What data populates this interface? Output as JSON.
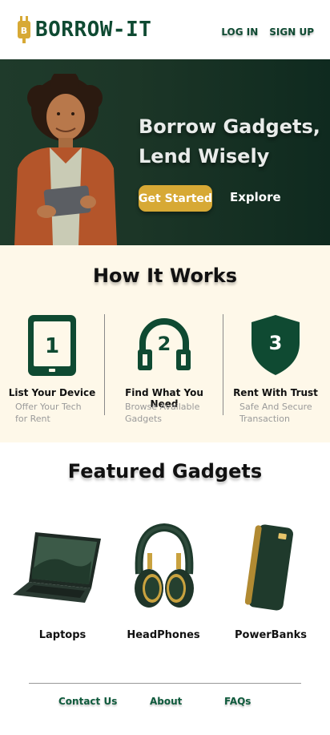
{
  "header": {
    "brand": "BORROW-IT",
    "login": "LOG IN",
    "signup": "SIGN UP"
  },
  "hero": {
    "title_line1": "Borrow Gadgets,",
    "title_line2": "Lend Wisely",
    "cta_primary": "Get Started",
    "cta_secondary": "Explore"
  },
  "how": {
    "title": "How It Works",
    "steps": [
      {
        "number": "1",
        "title": "List Your Device",
        "subtitle_line1": "Offer Your Tech",
        "subtitle_line2": "for Rent"
      },
      {
        "number": "2",
        "title": "Find What You Need",
        "subtitle_line1": "Browse Available",
        "subtitle_line2": "Gadgets"
      },
      {
        "number": "3",
        "title": "Rent With Trust",
        "subtitle_line1": "Safe And Secure",
        "subtitle_line2": "Transaction"
      }
    ]
  },
  "featured": {
    "title": "Featured Gadgets",
    "items": [
      {
        "label": "Laptops",
        "icon": "laptop-icon"
      },
      {
        "label": "HeadPhones",
        "icon": "headphones-icon"
      },
      {
        "label": "PowerBanks",
        "icon": "powerbank-icon"
      }
    ]
  },
  "footer": {
    "contact": "Contact Us",
    "about": "About",
    "faqs": "FAQs"
  },
  "colors": {
    "brand_green": "#0f4a32",
    "accent_gold": "#d7a935",
    "hero_bg": "#1c3627",
    "how_bg": "#fef8e9"
  }
}
